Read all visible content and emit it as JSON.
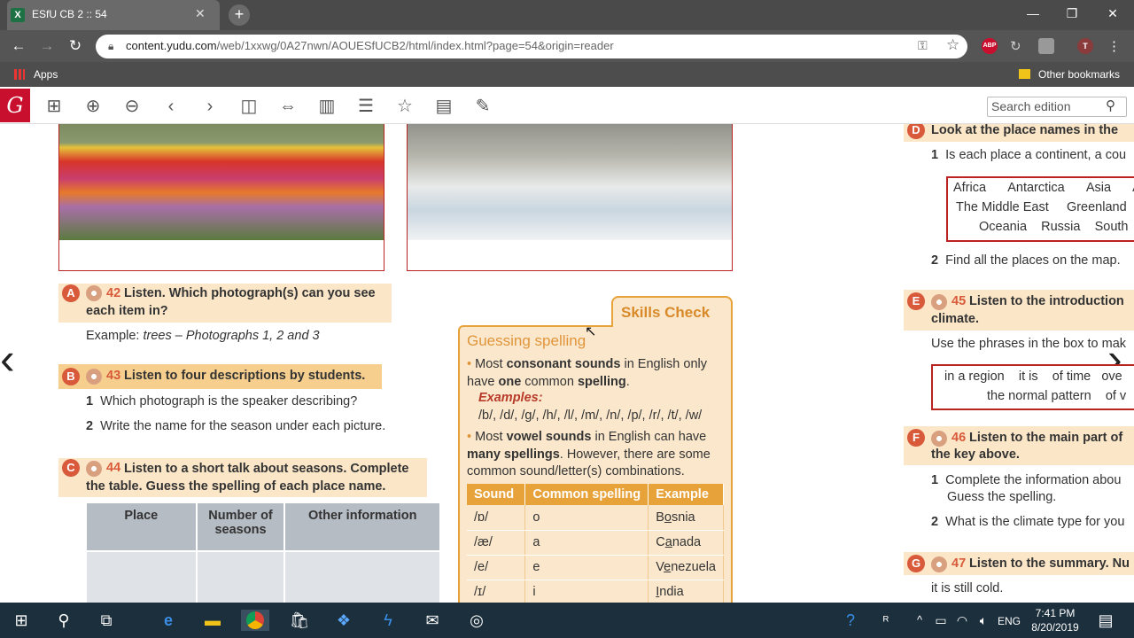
{
  "browser": {
    "tab_title": "ESfU CB 2 :: 54",
    "url_main": "content.yudu.com",
    "url_path": "/web/1xxwg/0A27nwn/AOUESfUCB2/html/index.html?page=54&origin=reader",
    "apps_label": "Apps",
    "other_bookmarks": "Other bookmarks",
    "profile_letter": "T",
    "abp_label": "ABP"
  },
  "reader": {
    "logo": "G",
    "search_placeholder": "Search edition"
  },
  "left": {
    "A": {
      "letter": "A",
      "num": "42",
      "text": "Listen. Which photograph(s) can you see each item in?",
      "example_label": "Example:",
      "example_text": "trees – Photographs 1, 2 and 3"
    },
    "B": {
      "letter": "B",
      "num": "43",
      "text": "Listen to four descriptions by students.",
      "items": [
        {
          "n": "1",
          "t": "Which photograph is the speaker describing?"
        },
        {
          "n": "2",
          "t": "Write the name for the season under each picture."
        }
      ]
    },
    "C": {
      "letter": "C",
      "num": "44",
      "text": "Listen to a short talk about seasons. Complete the table. Guess the spelling of each place name.",
      "headers": [
        "Place",
        "Number of seasons",
        "Other information"
      ]
    }
  },
  "skills": {
    "tab": "Skills Check",
    "title": "Guessing spelling",
    "b1_pre": "Most ",
    "b1_bold1": "consonant sounds",
    "b1_mid": " in English only have ",
    "b1_bold2": "one",
    "b1_mid2": " common ",
    "b1_bold3": "spelling",
    "b1_end": ".",
    "examples_label": "Examples:",
    "examples": "/b/, /d/, /g/, /h/, /l/, /m/, /n/, /p/, /r/, /t/, /w/",
    "b2_pre": "Most ",
    "b2_bold1": "vowel sounds",
    "b2_mid": " in English can have ",
    "b2_bold2": "many spellings",
    "b2_end": ". However, there are some common sound/letter(s) combinations.",
    "headers": [
      "Sound",
      "Common spelling",
      "Example"
    ],
    "rows": [
      {
        "sound": "/ɒ/",
        "spelling": "o",
        "ex_pre": "B",
        "ex_u": "o",
        "ex_post": "snia"
      },
      {
        "sound": "/æ/",
        "spelling": "a",
        "ex_pre": "C",
        "ex_u": "a",
        "ex_post": "nada"
      },
      {
        "sound": "/e/",
        "spelling": "e",
        "ex_pre": "V",
        "ex_u": "e",
        "ex_post": "nezuela"
      },
      {
        "sound": "/ɪ/",
        "spelling": "i",
        "ex_pre": "",
        "ex_u": "I",
        "ex_post": "ndia"
      }
    ]
  },
  "right": {
    "D": {
      "letter": "D",
      "text": "Look at the place names in the",
      "q1n": "1",
      "q1": "Is each place a continent, a cou",
      "places_row1": [
        "Africa",
        "Antarctica",
        "Asia",
        "Au"
      ],
      "places_row2": [
        "The Middle East",
        "Greenland"
      ],
      "places_row3": [
        "Oceania",
        "Russia",
        "South"
      ],
      "q2n": "2",
      "q2": "Find all the places on the map."
    },
    "E": {
      "letter": "E",
      "num": "45",
      "text": "Listen to the introduction",
      "text2": "climate.",
      "instr": "Use the phrases in the box to mak",
      "phr_row1": [
        "in a region",
        "it is",
        "of time",
        "ove"
      ],
      "phr_row2": [
        "the normal pattern",
        "of v"
      ]
    },
    "F": {
      "letter": "F",
      "num": "46",
      "text": "Listen to the main part of",
      "text2": "the key above.",
      "q1n": "1",
      "q1": "Complete the information abou",
      "q1b": "Guess the spelling.",
      "q2n": "2",
      "q2": "What is the climate type for you"
    },
    "G": {
      "letter": "G",
      "num": "47",
      "text": "Listen to the summary. Nu",
      "line": "it is still cold."
    }
  },
  "taskbar": {
    "lang": "ENG",
    "time": "7:41 PM",
    "date": "8/20/2019"
  }
}
